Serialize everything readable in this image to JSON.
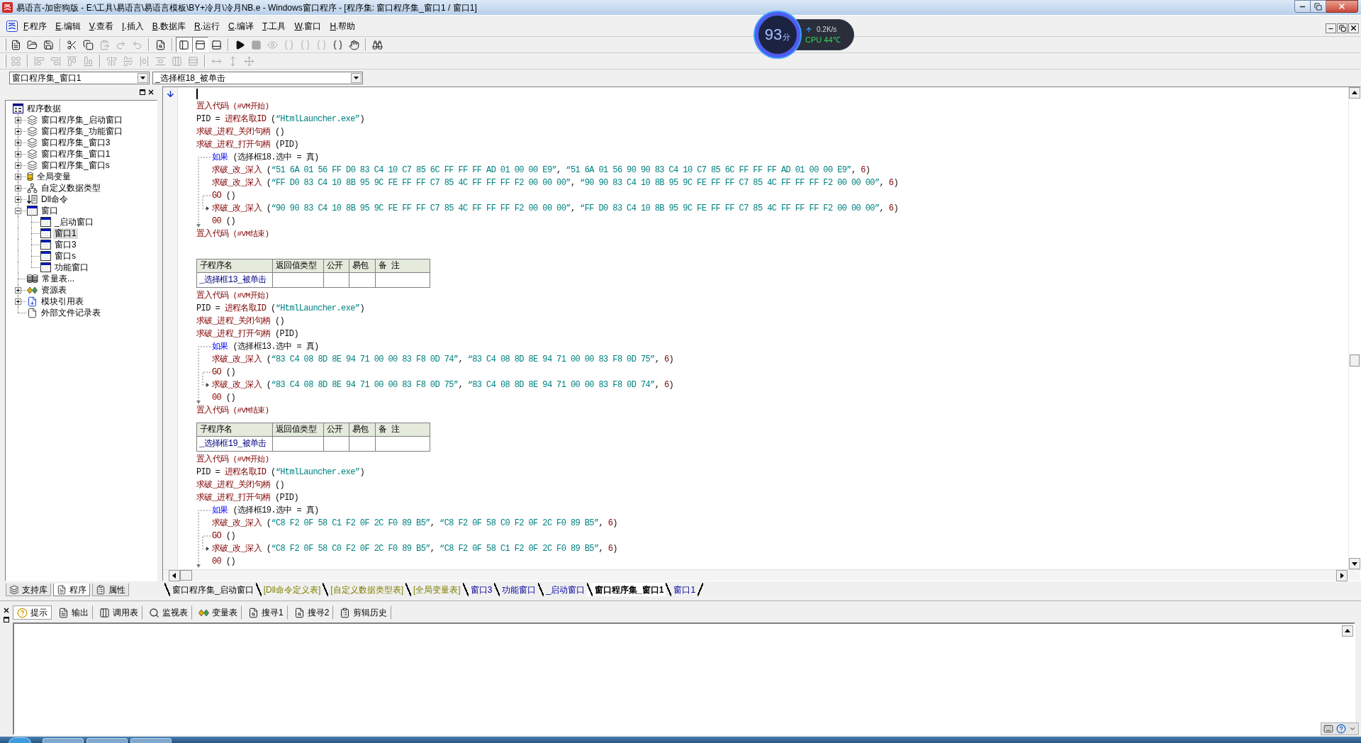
{
  "window": {
    "title": "易语言-加密狗版 - E:\\工具\\易语言\\易语言模板\\BY+冷月\\冷月NB.e - Windows窗口程序 - [程序集: 窗口程序集_窗口1 / 窗口1]"
  },
  "menu": [
    {
      "key": "F",
      "label": ".程序"
    },
    {
      "key": "E",
      "label": ".编辑"
    },
    {
      "key": "V",
      "label": ".查看"
    },
    {
      "key": "I",
      "label": ".插入"
    },
    {
      "key": "B",
      "label": ".数据库"
    },
    {
      "key": "R",
      "label": ".运行"
    },
    {
      "key": "C",
      "label": ".编译"
    },
    {
      "key": "T",
      "label": ".工具"
    },
    {
      "key": "W",
      "label": ".窗口"
    },
    {
      "key": "H",
      "label": ".帮助"
    }
  ],
  "toolbars": [
    [
      [
        {
          "kind": "new",
          "disabled": false
        },
        {
          "kind": "open",
          "disabled": false
        },
        {
          "kind": "save",
          "disabled": false
        }
      ],
      [
        {
          "kind": "cut",
          "disabled": false
        },
        {
          "kind": "copy",
          "disabled": false
        },
        {
          "kind": "paste",
          "disabled": true
        },
        {
          "kind": "redo",
          "disabled": true
        },
        {
          "kind": "undo",
          "disabled": true
        }
      ],
      [
        {
          "kind": "preview",
          "disabled": false
        }
      ],
      [
        {
          "kind": "layout-left",
          "disabled": false,
          "on": true
        },
        {
          "kind": "layout-top",
          "disabled": false,
          "on": true
        },
        {
          "kind": "layout-bottom",
          "disabled": false,
          "on": false
        }
      ],
      [
        {
          "kind": "run",
          "disabled": false
        },
        {
          "kind": "stop",
          "disabled": true
        },
        {
          "kind": "watch",
          "disabled": true
        },
        {
          "kind": "step-into",
          "disabled": true
        },
        {
          "kind": "step-over",
          "disabled": true
        },
        {
          "kind": "step-out",
          "disabled": true
        },
        {
          "kind": "run-to-cursor",
          "disabled": false
        },
        {
          "kind": "hand",
          "disabled": false
        }
      ],
      [
        {
          "kind": "help",
          "disabled": false
        }
      ]
    ],
    [
      [
        {
          "kind": "grid",
          "disabled": true
        }
      ],
      [
        {
          "kind": "align-left",
          "disabled": true
        },
        {
          "kind": "align-right",
          "disabled": true
        },
        {
          "kind": "align-top",
          "disabled": true
        },
        {
          "kind": "align-bottom",
          "disabled": true
        }
      ],
      [
        {
          "kind": "center-h",
          "disabled": true
        },
        {
          "kind": "center-v",
          "disabled": true
        },
        {
          "kind": "space-h",
          "disabled": true
        },
        {
          "kind": "space-v",
          "disabled": true
        },
        {
          "kind": "distribute-h",
          "disabled": true
        },
        {
          "kind": "distribute-v",
          "disabled": true
        }
      ],
      [
        {
          "kind": "same-width",
          "disabled": true
        },
        {
          "kind": "same-height",
          "disabled": true
        },
        {
          "kind": "same-size",
          "disabled": true
        }
      ]
    ]
  ],
  "selectors": [
    {
      "kind": "assembly",
      "value": "窗口程序集_窗口1"
    },
    {
      "kind": "event",
      "value": "_选择框18_被单击"
    }
  ],
  "tree": {
    "label": "程序数据",
    "kind": "program",
    "selected": false,
    "children": [
      {
        "label": "窗口程序集_启动窗口",
        "kind": "assembly",
        "expanded": false,
        "selected": false
      },
      {
        "label": "窗口程序集_功能窗口",
        "kind": "assembly",
        "expanded": false,
        "selected": false
      },
      {
        "label": "窗口程序集_窗口3",
        "kind": "assembly",
        "expanded": false,
        "selected": false
      },
      {
        "label": "窗口程序集_窗口1",
        "kind": "assembly",
        "expanded": false,
        "selected": false
      },
      {
        "label": "窗口程序集_窗口s",
        "kind": "assembly",
        "expanded": false,
        "selected": false
      },
      {
        "label": "全局变量",
        "kind": "globals",
        "expanded": false,
        "selected": false
      },
      {
        "label": "自定义数据类型",
        "kind": "types",
        "expanded": false,
        "selected": false
      },
      {
        "label": "Dll命令",
        "kind": "dll",
        "expanded": false,
        "selected": false
      },
      {
        "label": "窗口",
        "kind": "window",
        "expanded": true,
        "selected": false,
        "children": [
          {
            "label": "_启动窗口",
            "kind": "window",
            "selected": false
          },
          {
            "label": "窗口1",
            "kind": "window",
            "selected": true
          },
          {
            "label": "窗口3",
            "kind": "window",
            "selected": false
          },
          {
            "label": "窗口s",
            "kind": "window",
            "selected": false
          },
          {
            "label": "功能窗口",
            "kind": "window",
            "selected": false
          }
        ]
      },
      {
        "label": "常量表...",
        "kind": "constants",
        "selected": false
      },
      {
        "label": "资源表",
        "kind": "resources",
        "expanded": false,
        "selected": false
      },
      {
        "label": "模块引用表",
        "kind": "modules",
        "expanded": false,
        "selected": false
      },
      {
        "label": "外部文件记录表",
        "kind": "files",
        "selected": false
      }
    ]
  },
  "side_tabs": [
    {
      "label": "支持库",
      "kind": "library",
      "selected": false
    },
    {
      "label": "程序",
      "kind": "program",
      "selected": true
    },
    {
      "label": "属性",
      "kind": "properties",
      "selected": false
    }
  ],
  "editor": {
    "sections": [
      {
        "lines": [
          {
            "kind": "caret"
          },
          {
            "kind": "statement",
            "tokens": [
              {
                "kind": "command",
                "text": "置入代码"
              },
              {
                "kind": "macro",
                "text": " (#VM开始)"
              }
            ]
          },
          {
            "kind": "statement",
            "tokens": [
              {
                "kind": "plain",
                "text": "PID = "
              },
              {
                "kind": "command",
                "text": "进程名取ID"
              },
              {
                "kind": "plain",
                "text": " ("
              },
              {
                "kind": "string",
                "text": "“HtmlLauncher.exe”"
              },
              {
                "kind": "plain",
                "text": ")"
              }
            ]
          },
          {
            "kind": "statement",
            "tokens": [
              {
                "kind": "command",
                "text": "求破_进程_关闭句柄"
              },
              {
                "kind": "plain",
                "text": " ()"
              }
            ]
          },
          {
            "kind": "statement",
            "tokens": [
              {
                "kind": "command",
                "text": "求破_进程_打开句柄"
              },
              {
                "kind": "plain",
                "text": " (PID)"
              }
            ]
          },
          {
            "kind": "if",
            "tokens": [
              {
                "kind": "keyword",
                "text": "如果"
              },
              {
                "kind": "plain",
                "text": " (选择框18.选中 = 真)"
              }
            ],
            "then": [
              {
                "kind": "statement",
                "tokens": [
                  {
                    "kind": "command",
                    "text": "求破_改_深入"
                  },
                  {
                    "kind": "plain",
                    "text": " ("
                  },
                  {
                    "kind": "string",
                    "text": "“51 6A 01 56 FF D0 83 C4 10 C7 85 6C FF FF FF AD 01 00 00 E9”"
                  },
                  {
                    "kind": "plain",
                    "text": ", "
                  },
                  {
                    "kind": "string",
                    "text": "“51 6A 01 56 90 90 83 C4 10 C7 85 6C FF FF FF AD 01 00 00 E9”"
                  },
                  {
                    "kind": "plain",
                    "text": ", "
                  },
                  {
                    "kind": "number",
                    "text": "6"
                  },
                  {
                    "kind": "plain",
                    "text": ")"
                  }
                ]
              },
              {
                "kind": "statement",
                "tokens": [
                  {
                    "kind": "command",
                    "text": "求破_改_深入"
                  },
                  {
                    "kind": "plain",
                    "text": " ("
                  },
                  {
                    "kind": "string",
                    "text": "“FF D0 83 C4 10 8B 95 9C FE FF FF C7 85 4C FF FF FF F2 00 00 00”"
                  },
                  {
                    "kind": "plain",
                    "text": ", "
                  },
                  {
                    "kind": "string",
                    "text": "“90 90 83 C4 10 8B 95 9C FE FF FF C7 85 4C FF FF FF F2 00 00 00”"
                  },
                  {
                    "kind": "plain",
                    "text": ", "
                  },
                  {
                    "kind": "number",
                    "text": "6"
                  },
                  {
                    "kind": "plain",
                    "text": ")"
                  }
                ]
              },
              {
                "kind": "statement",
                "tokens": [
                  {
                    "kind": "command",
                    "text": "GO"
                  },
                  {
                    "kind": "plain",
                    "text": " ()"
                  }
                ]
              }
            ],
            "else": [
              {
                "kind": "statement",
                "tokens": [
                  {
                    "kind": "command",
                    "text": "求破_改_深入"
                  },
                  {
                    "kind": "plain",
                    "text": " ("
                  },
                  {
                    "kind": "string",
                    "text": "“90 90 83 C4 10 8B 95 9C FE FF FF C7 85 4C FF FF FF F2 00 00 00”"
                  },
                  {
                    "kind": "plain",
                    "text": ", "
                  },
                  {
                    "kind": "string",
                    "text": "“FF D0 83 C4 10 8B 95 9C FE FF FF C7 85 4C FF FF FF F2 00 00 00”"
                  },
                  {
                    "kind": "plain",
                    "text": ", "
                  },
                  {
                    "kind": "number",
                    "text": "6"
                  },
                  {
                    "kind": "plain",
                    "text": ")"
                  }
                ]
              },
              {
                "kind": "statement",
                "tokens": [
                  {
                    "kind": "command",
                    "text": "00"
                  },
                  {
                    "kind": "plain",
                    "text": " ()"
                  }
                ]
              }
            ]
          },
          {
            "kind": "statement",
            "tokens": [
              {
                "kind": "command",
                "text": "置入代码"
              },
              {
                "kind": "macro",
                "text": " (#VM结束)"
              }
            ]
          }
        ]
      },
      {
        "table": {
          "columns": [
            "子程序名",
            "返回值类型",
            "公开",
            "易包",
            "备 注"
          ],
          "name": "_选择框13_被单击"
        },
        "lines": [
          {
            "kind": "statement",
            "tokens": [
              {
                "kind": "command",
                "text": "置入代码"
              },
              {
                "kind": "macro",
                "text": " (#VM开始)"
              }
            ]
          },
          {
            "kind": "statement",
            "tokens": [
              {
                "kind": "plain",
                "text": "PID = "
              },
              {
                "kind": "command",
                "text": "进程名取ID"
              },
              {
                "kind": "plain",
                "text": " ("
              },
              {
                "kind": "string",
                "text": "“HtmlLauncher.exe”"
              },
              {
                "kind": "plain",
                "text": ")"
              }
            ]
          },
          {
            "kind": "statement",
            "tokens": [
              {
                "kind": "command",
                "text": "求破_进程_关闭句柄"
              },
              {
                "kind": "plain",
                "text": " ()"
              }
            ]
          },
          {
            "kind": "statement",
            "tokens": [
              {
                "kind": "command",
                "text": "求破_进程_打开句柄"
              },
              {
                "kind": "plain",
                "text": " (PID)"
              }
            ]
          },
          {
            "kind": "if",
            "tokens": [
              {
                "kind": "keyword",
                "text": "如果"
              },
              {
                "kind": "plain",
                "text": " (选择框13.选中 = 真)"
              }
            ],
            "then": [
              {
                "kind": "statement",
                "tokens": [
                  {
                    "kind": "command",
                    "text": "求破_改_深入"
                  },
                  {
                    "kind": "plain",
                    "text": " ("
                  },
                  {
                    "kind": "string",
                    "text": "“83 C4 08 8D 8E 94 71 00 00 83 F8 0D 74”"
                  },
                  {
                    "kind": "plain",
                    "text": ", "
                  },
                  {
                    "kind": "string",
                    "text": "“83 C4 08 8D 8E 94 71 00 00 83 F8 0D 75”"
                  },
                  {
                    "kind": "plain",
                    "text": ", "
                  },
                  {
                    "kind": "number",
                    "text": "6"
                  },
                  {
                    "kind": "plain",
                    "text": ")"
                  }
                ]
              },
              {
                "kind": "statement",
                "tokens": [
                  {
                    "kind": "command",
                    "text": "GO"
                  },
                  {
                    "kind": "plain",
                    "text": " ()"
                  }
                ]
              }
            ],
            "else": [
              {
                "kind": "statement",
                "tokens": [
                  {
                    "kind": "command",
                    "text": "求破_改_深入"
                  },
                  {
                    "kind": "plain",
                    "text": " ("
                  },
                  {
                    "kind": "string",
                    "text": "“83 C4 08 8D 8E 94 71 00 00 83 F8 0D 75”"
                  },
                  {
                    "kind": "plain",
                    "text": ", "
                  },
                  {
                    "kind": "string",
                    "text": "“83 C4 08 8D 8E 94 71 00 00 83 F8 0D 74”"
                  },
                  {
                    "kind": "plain",
                    "text": ", "
                  },
                  {
                    "kind": "number",
                    "text": "6"
                  },
                  {
                    "kind": "plain",
                    "text": ")"
                  }
                ]
              },
              {
                "kind": "statement",
                "tokens": [
                  {
                    "kind": "command",
                    "text": "00"
                  },
                  {
                    "kind": "plain",
                    "text": " ()"
                  }
                ]
              }
            ]
          },
          {
            "kind": "statement",
            "tokens": [
              {
                "kind": "command",
                "text": "置入代码"
              },
              {
                "kind": "macro",
                "text": " (#VM结束)"
              }
            ]
          }
        ]
      },
      {
        "table": {
          "columns": [
            "子程序名",
            "返回值类型",
            "公开",
            "易包",
            "备 注"
          ],
          "name": "_选择框19_被单击"
        },
        "lines": [
          {
            "kind": "statement",
            "tokens": [
              {
                "kind": "command",
                "text": "置入代码"
              },
              {
                "kind": "macro",
                "text": " (#VM开始)"
              }
            ]
          },
          {
            "kind": "statement",
            "tokens": [
              {
                "kind": "plain",
                "text": "PID = "
              },
              {
                "kind": "command",
                "text": "进程名取ID"
              },
              {
                "kind": "plain",
                "text": " ("
              },
              {
                "kind": "string",
                "text": "“HtmlLauncher.exe”"
              },
              {
                "kind": "plain",
                "text": ")"
              }
            ]
          },
          {
            "kind": "statement",
            "tokens": [
              {
                "kind": "command",
                "text": "求破_进程_关闭句柄"
              },
              {
                "kind": "plain",
                "text": " ()"
              }
            ]
          },
          {
            "kind": "statement",
            "tokens": [
              {
                "kind": "command",
                "text": "求破_进程_打开句柄"
              },
              {
                "kind": "plain",
                "text": " (PID)"
              }
            ]
          },
          {
            "kind": "if",
            "tokens": [
              {
                "kind": "keyword",
                "text": "如果"
              },
              {
                "kind": "plain",
                "text": " (选择框19.选中 = 真)"
              }
            ],
            "then": [
              {
                "kind": "statement",
                "tokens": [
                  {
                    "kind": "command",
                    "text": "求破_改_深入"
                  },
                  {
                    "kind": "plain",
                    "text": " ("
                  },
                  {
                    "kind": "string",
                    "text": "“C8 F2 0F 58 C1 F2 0F 2C F0 89 B5”"
                  },
                  {
                    "kind": "plain",
                    "text": ", "
                  },
                  {
                    "kind": "string",
                    "text": "“C8 F2 0F 58 C0 F2 0F 2C F0 89 B5”"
                  },
                  {
                    "kind": "plain",
                    "text": ", "
                  },
                  {
                    "kind": "number",
                    "text": "6"
                  },
                  {
                    "kind": "plain",
                    "text": ")"
                  }
                ]
              },
              {
                "kind": "statement",
                "tokens": [
                  {
                    "kind": "command",
                    "text": "GO"
                  },
                  {
                    "kind": "plain",
                    "text": " ()"
                  }
                ]
              }
            ],
            "else": [
              {
                "kind": "statement",
                "tokens": [
                  {
                    "kind": "command",
                    "text": "求破_改_深入"
                  },
                  {
                    "kind": "plain",
                    "text": " ("
                  },
                  {
                    "kind": "string",
                    "text": "“C8 F2 0F 58 C0 F2 0F 2C F0 89 B5”"
                  },
                  {
                    "kind": "plain",
                    "text": ", "
                  },
                  {
                    "kind": "string",
                    "text": "“C8 F2 0F 58 C1 F2 0F 2C F0 89 B5”"
                  },
                  {
                    "kind": "plain",
                    "text": ", "
                  },
                  {
                    "kind": "number",
                    "text": "6"
                  },
                  {
                    "kind": "plain",
                    "text": ")"
                  }
                ]
              },
              {
                "kind": "statement",
                "tokens": [
                  {
                    "kind": "command",
                    "text": "00"
                  },
                  {
                    "kind": "plain",
                    "text": " ()"
                  }
                ]
              }
            ]
          }
        ]
      }
    ]
  },
  "editor_tabs": [
    {
      "label": "窗口程序集_启动窗口",
      "kind": "assembly",
      "selected": false
    },
    {
      "label": "[Dll命令定义表]",
      "kind": "table",
      "selected": false
    },
    {
      "label": "[自定义数据类型表]",
      "kind": "table",
      "selected": false
    },
    {
      "label": "[全局变量表]",
      "kind": "table",
      "selected": false
    },
    {
      "label": "窗口3",
      "kind": "window",
      "selected": false
    },
    {
      "label": "功能窗口",
      "kind": "window",
      "selected": false
    },
    {
      "label": "_启动窗口",
      "kind": "window",
      "selected": false
    },
    {
      "label": "窗口程序集_窗口1",
      "kind": "assembly",
      "selected": true
    },
    {
      "label": "窗口1",
      "kind": "window",
      "selected": false
    }
  ],
  "output_tabs": [
    {
      "label": "提示",
      "kind": "hint",
      "selected": true
    },
    {
      "label": "输出",
      "kind": "output",
      "selected": false
    },
    {
      "label": "调用表",
      "kind": "calls",
      "selected": false
    },
    {
      "label": "监视表",
      "kind": "watch",
      "selected": false
    },
    {
      "label": "变量表",
      "kind": "variables",
      "selected": false
    },
    {
      "label": "搜寻1",
      "kind": "search",
      "selected": false
    },
    {
      "label": "搜寻2",
      "kind": "search",
      "selected": false
    },
    {
      "label": "剪辑历史",
      "kind": "history",
      "selected": false
    }
  ],
  "monitor_widget": {
    "score": "93",
    "unit": "分",
    "speed": "0.2K/s",
    "cpu": "CPU 44℃"
  }
}
